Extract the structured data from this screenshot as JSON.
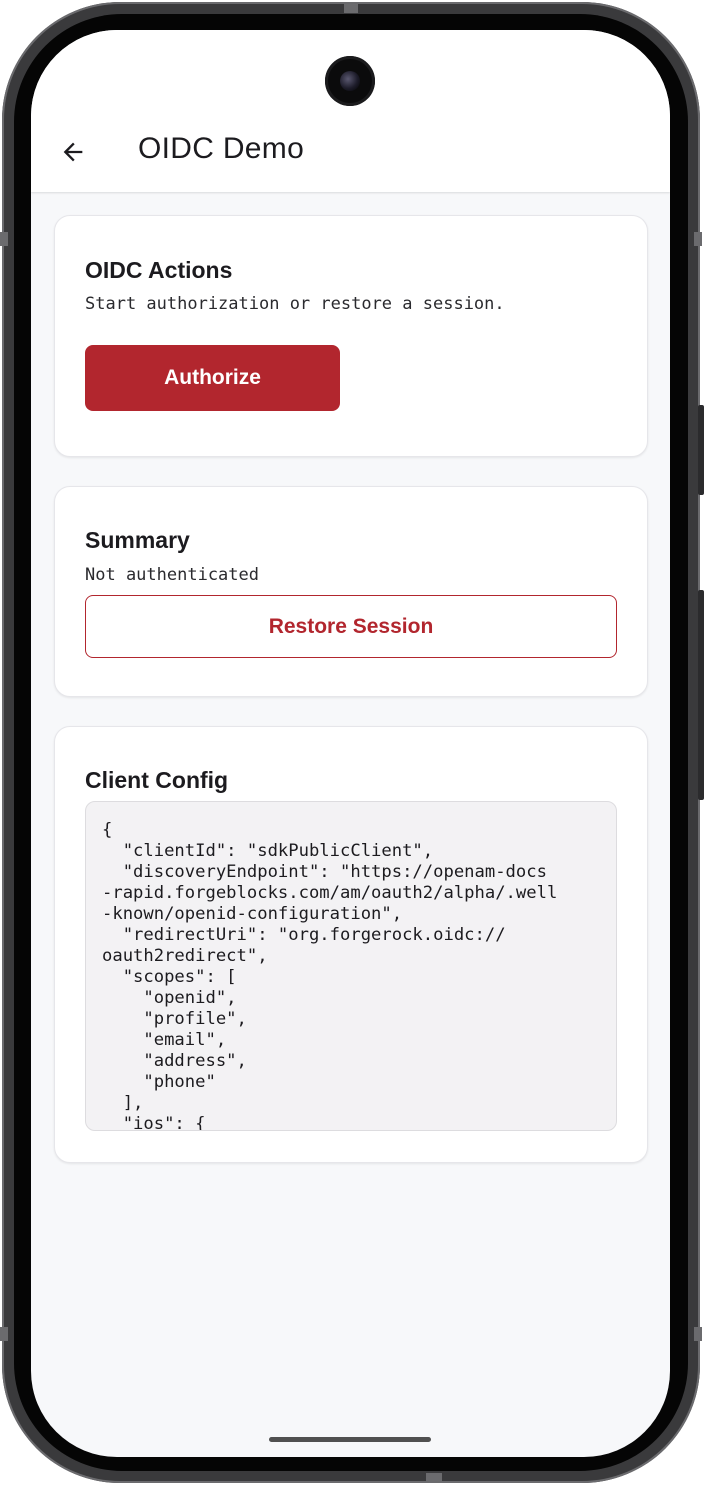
{
  "appbar": {
    "title": "OIDC Demo",
    "back_icon": "arrow-back-icon"
  },
  "actions_card": {
    "title": "OIDC Actions",
    "subtitle": "Start authorization or restore a session.",
    "authorize_label": "Authorize"
  },
  "summary_card": {
    "title": "Summary",
    "status": "Not authenticated",
    "restore_label": "Restore Session"
  },
  "config_card": {
    "title": "Client Config",
    "json_text": "{\n  \"clientId\": \"sdkPublicClient\",\n  \"discoveryEndpoint\": \"https://openam-docs\n-rapid.forgeblocks.com/am/oauth2/alpha/.well\n-known/openid-configuration\",\n  \"redirectUri\": \"org.forgerock.oidc://\noauth2redirect\",\n  \"scopes\": [\n    \"openid\",\n    \"profile\",\n    \"email\",\n    \"address\",\n    \"phone\"\n  ],\n  \"ios\": {"
  },
  "colors": {
    "accent": "#b2262e",
    "background": "#f7f8fa",
    "card": "#ffffff",
    "code_bg": "#f3f2f4"
  }
}
